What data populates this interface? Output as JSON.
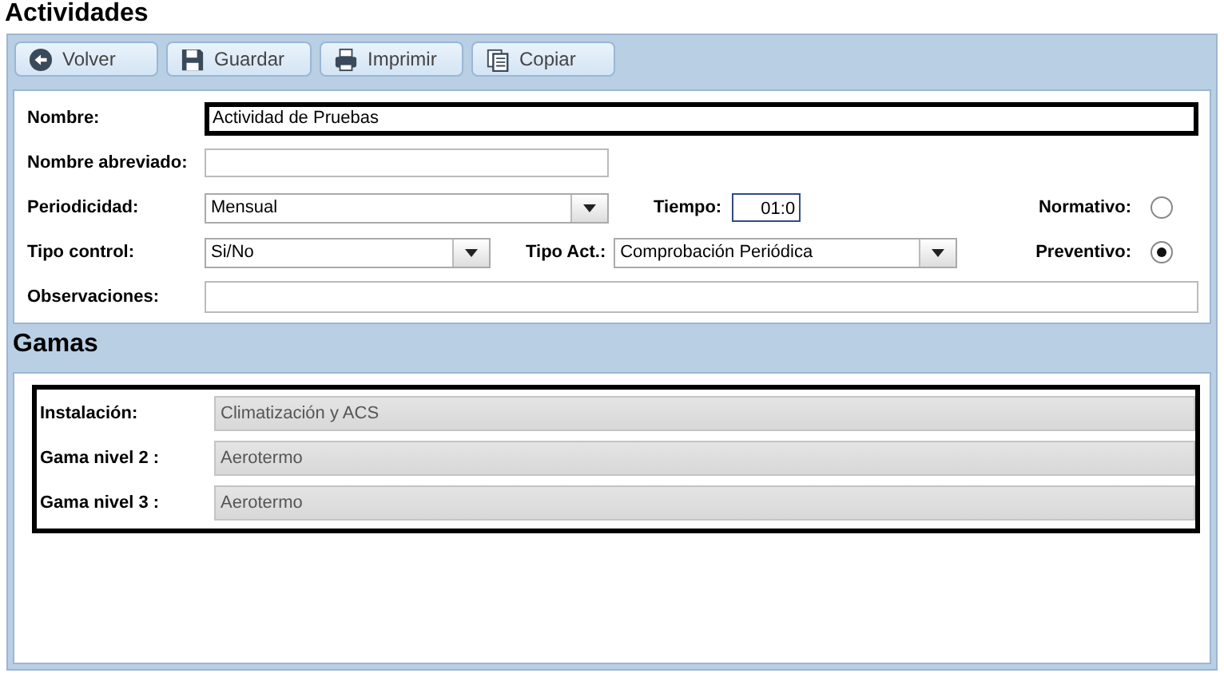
{
  "title": "Actividades",
  "toolbar": [
    {
      "label": "Volver"
    },
    {
      "label": "Guardar"
    },
    {
      "label": "Imprimir"
    },
    {
      "label": "Copiar"
    }
  ],
  "form": {
    "nombre": {
      "label": "Nombre:",
      "value": "Actividad de Pruebas"
    },
    "nombre_abreviado": {
      "label": "Nombre abreviado:"
    },
    "periodicidad": {
      "label": "Periodicidad:",
      "value": "Mensual"
    },
    "tiempo": {
      "label": "Tiempo:",
      "value": "01:0"
    },
    "normativo": {
      "label": "Normativo:",
      "checked": false
    },
    "tipo_control": {
      "label": "Tipo control:",
      "value": "Si/No"
    },
    "tipo_act": {
      "label": "Tipo Act.:",
      "value": "Comprobación Periódica"
    },
    "preventivo": {
      "label": "Preventivo:",
      "checked": true
    },
    "observaciones": {
      "label": "Observaciones:"
    }
  },
  "gamas": {
    "title": "Gamas",
    "rows": [
      {
        "label": "Instalación:",
        "value": "Climatización y ACS"
      },
      {
        "label": "Gama nivel 2 :",
        "value": "Aerotermo"
      },
      {
        "label": "Gama nivel 3 :",
        "value": "Aerotermo"
      }
    ]
  }
}
